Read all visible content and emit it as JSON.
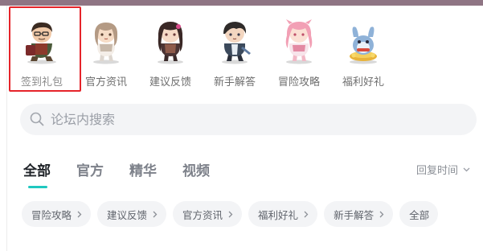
{
  "quick_entries": [
    {
      "label": "签到礼包",
      "icon": "checkin-gift-character-icon",
      "selected": true
    },
    {
      "label": "官方资讯",
      "icon": "official-news-character-icon"
    },
    {
      "label": "建议反馈",
      "icon": "feedback-character-icon"
    },
    {
      "label": "新手解答",
      "icon": "newbie-help-character-icon"
    },
    {
      "label": "冒险攻略",
      "icon": "adventure-guide-character-icon"
    },
    {
      "label": "福利好礼",
      "icon": "welfare-gift-mascot-icon"
    }
  ],
  "search": {
    "placeholder": "论坛内搜索"
  },
  "tabs": [
    {
      "label": "全部",
      "active": true
    },
    {
      "label": "官方"
    },
    {
      "label": "精华"
    },
    {
      "label": "视频"
    }
  ],
  "sort": {
    "label": "回复时间"
  },
  "filters": [
    {
      "label": "冒险攻略"
    },
    {
      "label": "建议反馈"
    },
    {
      "label": "官方资讯"
    },
    {
      "label": "福利好礼"
    },
    {
      "label": "新手解答"
    },
    {
      "label": "全部"
    }
  ],
  "colors": {
    "accent": "#1fc8c0",
    "selection": "#e5242a",
    "top_strip": "#8f7584",
    "chip_bg": "#f3f4f6"
  }
}
